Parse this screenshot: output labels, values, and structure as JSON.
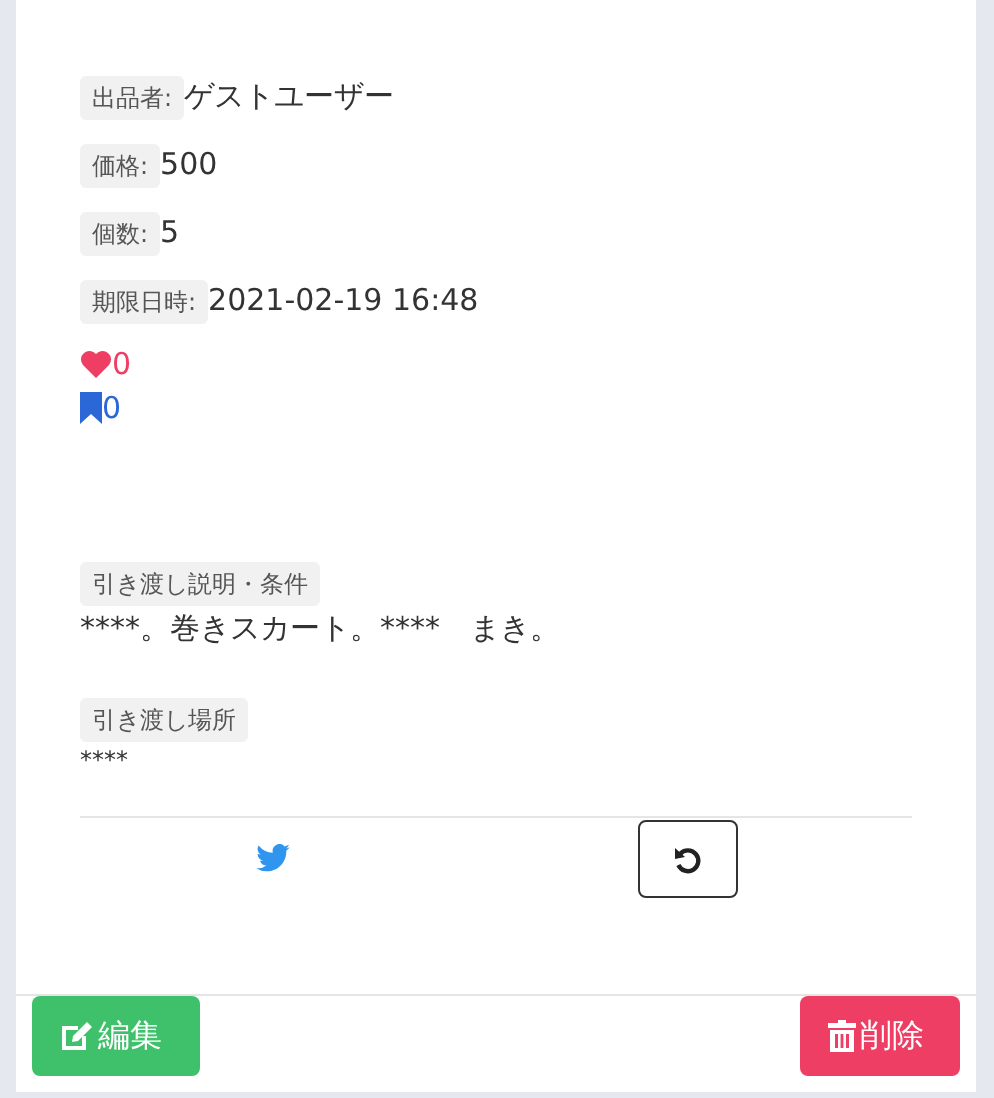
{
  "fields": [
    {
      "label": "出品者:",
      "value": "ゲストユーザー"
    },
    {
      "label": "価格:",
      "value": "500"
    },
    {
      "label": "個数:",
      "value": "5"
    },
    {
      "label": "期限日時:",
      "value": "2021-02-19 16:48"
    }
  ],
  "likes": "0",
  "bookmarks": "0",
  "sections": [
    {
      "label": "引き渡し説明・条件",
      "text": "****。巻きスカート。****　まき。",
      "kind": "paragraph"
    },
    {
      "label": "引き渡し場所",
      "text": "****",
      "kind": "note"
    }
  ],
  "footer": {
    "edit": "編集",
    "delete": "削除"
  }
}
